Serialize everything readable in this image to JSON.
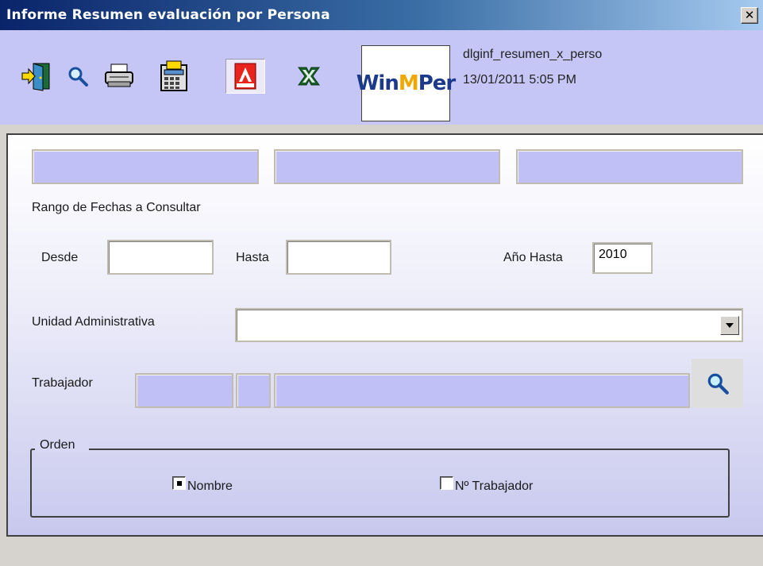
{
  "window": {
    "title": "Informe Resumen evaluación por Persona",
    "close_glyph": "✕"
  },
  "toolbar": {
    "icons": [
      "exit-icon",
      "search-icon",
      "printer-icon",
      "calculator-icon",
      "adobe-pdf-icon",
      "excel-icon"
    ],
    "logo_text_a": "Win",
    "logo_text_b": "M",
    "logo_text_c": "Per",
    "form_name": "dlginf_resumen_x_perso",
    "timestamp": "13/01/2011 5:05 PM"
  },
  "form": {
    "date_range_label": "Rango de Fechas a Consultar",
    "desde_label": "Desde",
    "desde_value": "",
    "hasta_label": "Hasta",
    "hasta_value": "",
    "anio_label": "Año Hasta",
    "anio_value": "2010",
    "unidad_label": "Unidad Administrativa",
    "unidad_value": "",
    "trabajador_label": "Trabajador",
    "orden": {
      "legend": "Orden",
      "options": [
        {
          "label": "Nombre",
          "selected": true
        },
        {
          "label": "Nº Trabajador",
          "selected": false
        }
      ]
    }
  },
  "colors": {
    "toolbar_bg": "#c6c6f6",
    "field_bg": "#c0c0f6",
    "title_gradient_start": "#0a246a"
  }
}
